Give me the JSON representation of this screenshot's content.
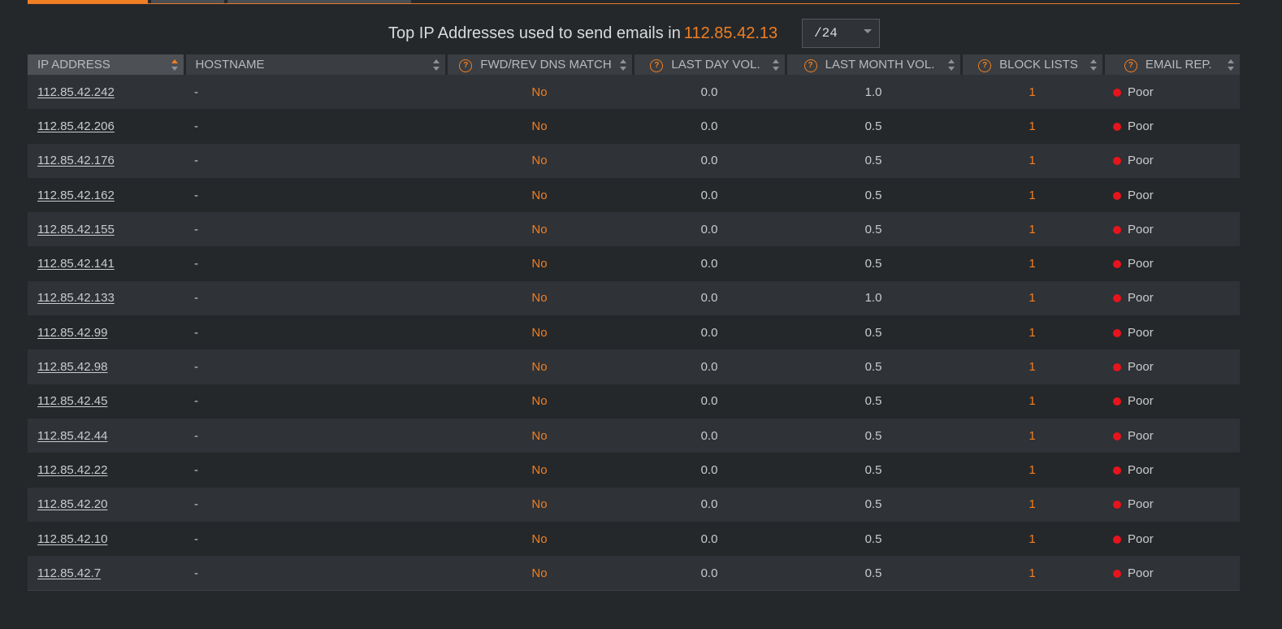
{
  "tabs": [
    {
      "label": ""
    },
    {
      "label": ""
    },
    {
      "label": ""
    }
  ],
  "title": {
    "text": "Top IP Addresses used to send emails in",
    "ip": "112.85.42.13"
  },
  "subnet_select": {
    "value": "/24"
  },
  "columns": [
    {
      "label": "IP ADDRESS",
      "help": false,
      "sorted": true
    },
    {
      "label": "HOSTNAME",
      "help": false,
      "sorted": false
    },
    {
      "label": "FWD/REV DNS MATCH",
      "help": true,
      "sorted": false
    },
    {
      "label": "LAST DAY VOL.",
      "help": true,
      "sorted": false
    },
    {
      "label": "LAST MONTH VOL.",
      "help": true,
      "sorted": false
    },
    {
      "label": "BLOCK LISTS",
      "help": true,
      "sorted": false
    },
    {
      "label": "EMAIL REP.",
      "help": true,
      "sorted": false
    }
  ],
  "rows": [
    {
      "ip": "112.85.42.242",
      "hostname": "-",
      "dns_match": "No",
      "last_day": "0.0",
      "last_month": "1.0",
      "block_lists": "1",
      "rep": "Poor"
    },
    {
      "ip": "112.85.42.206",
      "hostname": "-",
      "dns_match": "No",
      "last_day": "0.0",
      "last_month": "0.5",
      "block_lists": "1",
      "rep": "Poor"
    },
    {
      "ip": "112.85.42.176",
      "hostname": "-",
      "dns_match": "No",
      "last_day": "0.0",
      "last_month": "0.5",
      "block_lists": "1",
      "rep": "Poor"
    },
    {
      "ip": "112.85.42.162",
      "hostname": "-",
      "dns_match": "No",
      "last_day": "0.0",
      "last_month": "0.5",
      "block_lists": "1",
      "rep": "Poor"
    },
    {
      "ip": "112.85.42.155",
      "hostname": "-",
      "dns_match": "No",
      "last_day": "0.0",
      "last_month": "0.5",
      "block_lists": "1",
      "rep": "Poor"
    },
    {
      "ip": "112.85.42.141",
      "hostname": "-",
      "dns_match": "No",
      "last_day": "0.0",
      "last_month": "0.5",
      "block_lists": "1",
      "rep": "Poor"
    },
    {
      "ip": "112.85.42.133",
      "hostname": "-",
      "dns_match": "No",
      "last_day": "0.0",
      "last_month": "1.0",
      "block_lists": "1",
      "rep": "Poor"
    },
    {
      "ip": "112.85.42.99",
      "hostname": "-",
      "dns_match": "No",
      "last_day": "0.0",
      "last_month": "0.5",
      "block_lists": "1",
      "rep": "Poor"
    },
    {
      "ip": "112.85.42.98",
      "hostname": "-",
      "dns_match": "No",
      "last_day": "0.0",
      "last_month": "0.5",
      "block_lists": "1",
      "rep": "Poor"
    },
    {
      "ip": "112.85.42.45",
      "hostname": "-",
      "dns_match": "No",
      "last_day": "0.0",
      "last_month": "0.5",
      "block_lists": "1",
      "rep": "Poor"
    },
    {
      "ip": "112.85.42.44",
      "hostname": "-",
      "dns_match": "No",
      "last_day": "0.0",
      "last_month": "0.5",
      "block_lists": "1",
      "rep": "Poor"
    },
    {
      "ip": "112.85.42.22",
      "hostname": "-",
      "dns_match": "No",
      "last_day": "0.0",
      "last_month": "0.5",
      "block_lists": "1",
      "rep": "Poor"
    },
    {
      "ip": "112.85.42.20",
      "hostname": "-",
      "dns_match": "No",
      "last_day": "0.0",
      "last_month": "0.5",
      "block_lists": "1",
      "rep": "Poor"
    },
    {
      "ip": "112.85.42.10",
      "hostname": "-",
      "dns_match": "No",
      "last_day": "0.0",
      "last_month": "0.5",
      "block_lists": "1",
      "rep": "Poor"
    },
    {
      "ip": "112.85.42.7",
      "hostname": "-",
      "dns_match": "No",
      "last_day": "0.0",
      "last_month": "0.5",
      "block_lists": "1",
      "rep": "Poor"
    }
  ],
  "icons": {
    "help": "help-circle-icon",
    "sort": "sort-arrows-icon",
    "rep_status": "status-dot-icon",
    "dropdown": "chevron-down-icon"
  },
  "colors": {
    "accent": "#f07f22",
    "background": "#25282b",
    "row_alt": "#2f3236",
    "header": "#3a3d41",
    "poor": "#e8141c"
  }
}
